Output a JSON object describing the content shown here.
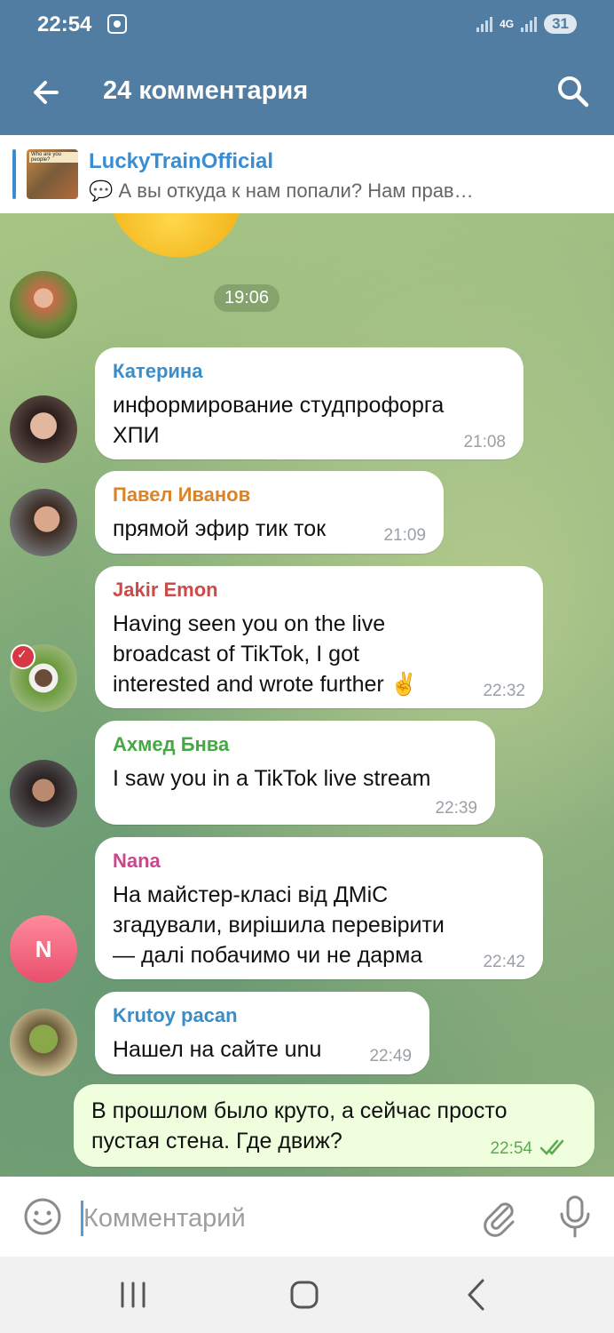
{
  "status_bar": {
    "time": "22:54",
    "network": "4G",
    "battery": "31"
  },
  "header": {
    "title": "24 комментария"
  },
  "pinned": {
    "name": "LuckyTrainOfficial",
    "text": "💬 А вы откуда к нам попали? Нам прав…"
  },
  "date_chip": "19:06",
  "messages": [
    {
      "sender": "Катерина",
      "sender_color": "#3a8dc7",
      "text": "информирование студпрофорга\nХПИ",
      "time": "21:08"
    },
    {
      "sender": "Павел Иванов",
      "sender_color": "#d9842b",
      "text": "прямой эфир тик ток",
      "time": "21:09"
    },
    {
      "sender": "Jakir Emon",
      "sender_color": "#cd4a4a",
      "text": "Having seen you on the live\nbroadcast of TikTok, I got\ninterested and wrote further ✌️",
      "time": "22:32"
    },
    {
      "sender": "Ахмед Бнва",
      "sender_color": "#45a844",
      "text": "I saw you in a TikTok live stream",
      "time": "22:39"
    },
    {
      "sender": "Nana",
      "sender_color": "#c9478a",
      "text": "На майстер-класі від ДМіС\nзгадували, вирішила перевірити\n— далі побачимо чи не дарма",
      "time": "22:42"
    },
    {
      "sender": "Krutoy pacan",
      "sender_color": "#3a8dc7",
      "text": "Нашел на сайте unu",
      "time": "22:49"
    }
  ],
  "own_message": {
    "text": "В прошлом было круто, а сейчас просто\nпустая стена. Где движ?",
    "time": "22:54"
  },
  "avatar_initial": "N",
  "composer": {
    "placeholder": "Комментарий",
    "value": ""
  }
}
